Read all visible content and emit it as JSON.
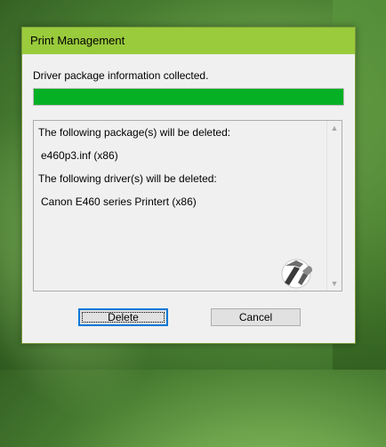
{
  "window": {
    "title": "Print Management"
  },
  "status_text": "Driver package information collected.",
  "progress": {
    "value_percent": 100,
    "color": "#06b025"
  },
  "details": {
    "packages_heading": "The following package(s) will be deleted:",
    "packages": [
      "e460p3.inf (x86)"
    ],
    "drivers_heading": "The following driver(s) will be deleted:",
    "drivers": [
      "Canon E460 series Printert (x86)"
    ]
  },
  "buttons": {
    "delete_label": "Delete",
    "cancel_label": "Cancel"
  },
  "colors": {
    "titlebar": "#9acb3c",
    "dialog_bg": "#f0f0f0",
    "progress_fill": "#06b025"
  },
  "icons": {
    "logo": "hammer-wrench-icon",
    "scroll_up": "scroll-up-arrow-icon",
    "scroll_down": "scroll-down-arrow-icon"
  }
}
